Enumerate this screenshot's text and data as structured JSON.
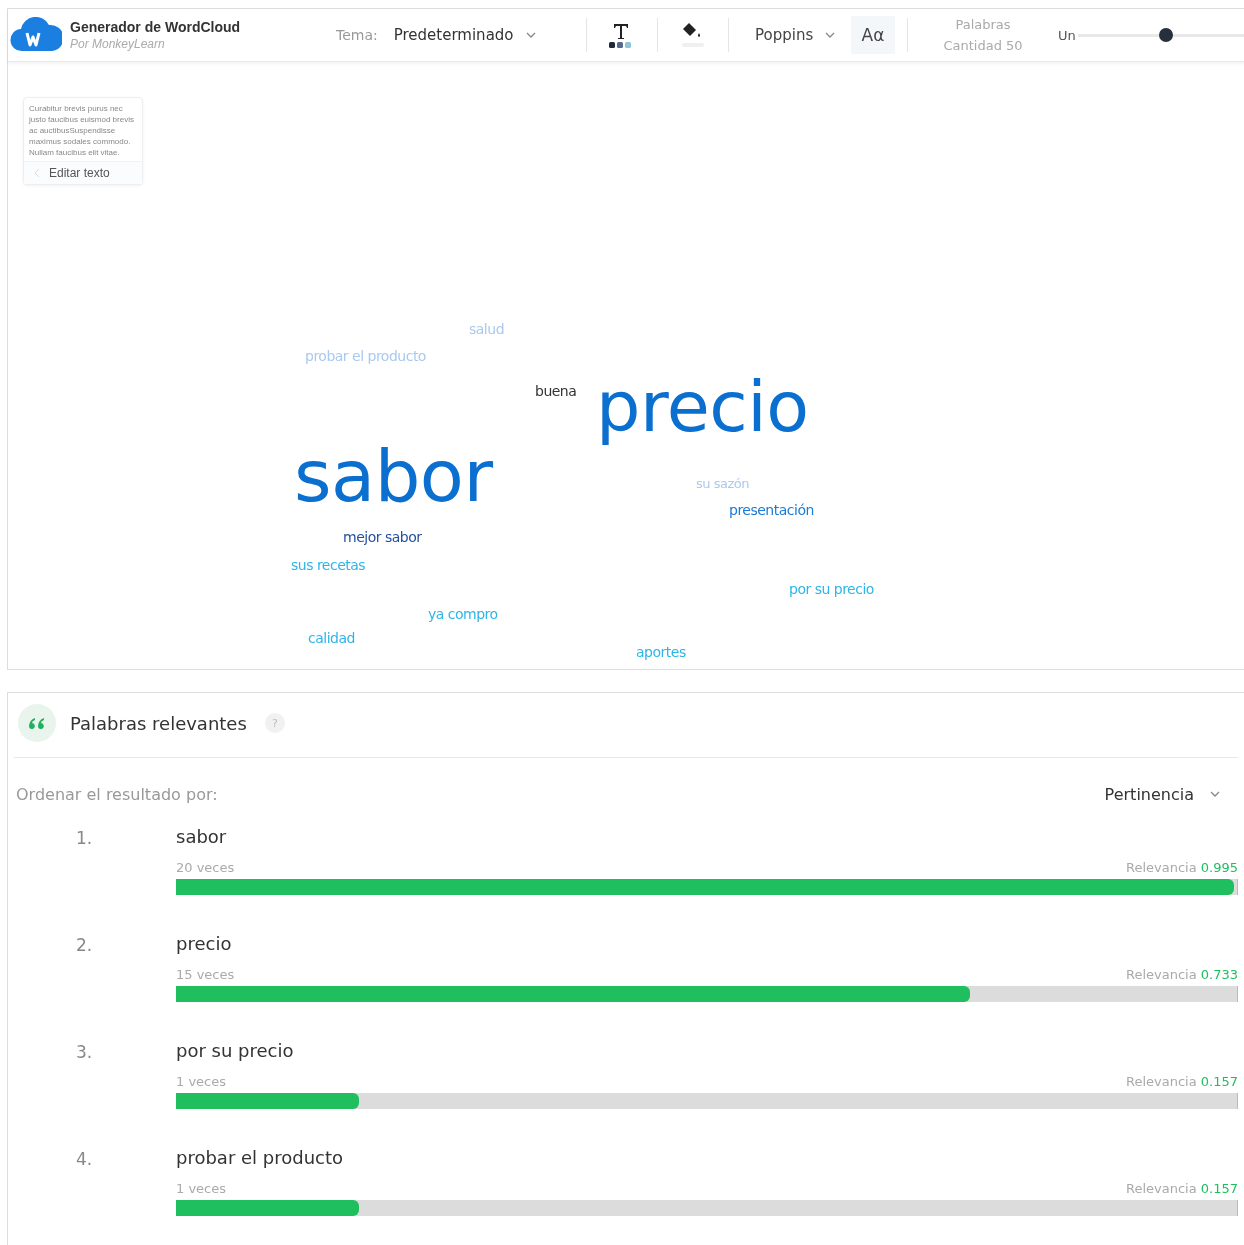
{
  "app": {
    "title": "Generador de WordCloud",
    "subtitle": "Por MonkeyLearn"
  },
  "toolbar": {
    "theme_label": "Tema:",
    "theme": "Predeterminado",
    "font": "Poppins",
    "case_button": "Aα",
    "words_label": "Palabras",
    "words_count": "Cantidad 50",
    "slider_label": "Un",
    "slider": {
      "level": 0.53
    }
  },
  "text_card": {
    "preview": "Curabitur brevis purus nec justo faucibus euismod brevis ac auctibusSuspendisse maximus sodales commodo. Nullam faucibus elit vitae.",
    "edit_button": "Editar texto"
  },
  "cloud": [
    {
      "text": "salud",
      "color": "#a9c9ef"
    },
    {
      "text": "probar el producto",
      "color": "#a9c9ef"
    },
    {
      "text": "buena",
      "color": "#333333"
    },
    {
      "text": "precio",
      "color": "#0b6fd0"
    },
    {
      "text": "sabor",
      "color": "#0b6fd0"
    },
    {
      "text": "su sazón",
      "color": "#a9c9ef"
    },
    {
      "text": "presentación",
      "color": "#1b7ad6"
    },
    {
      "text": "mejor sabor",
      "color": "#23509e"
    },
    {
      "text": "sus recetas",
      "color": "#2eb5e8"
    },
    {
      "text": "por su precio",
      "color": "#2eb5e8"
    },
    {
      "text": "ya compro",
      "color": "#2eb5e8"
    },
    {
      "text": "calidad",
      "color": "#2eb5e8"
    },
    {
      "text": "aportes",
      "color": "#2eb5e8"
    }
  ],
  "results": {
    "title": "Palabras relevantes",
    "help": "?",
    "sort_label": "Ordenar el resultado por:",
    "sort_value": "Pertinencia",
    "rows": [
      {
        "rank": "1.",
        "word": "sabor",
        "count": "20 veces",
        "relevance_label": "Relevancia",
        "relevance": "0.995",
        "level": 1.0
      },
      {
        "rank": "2.",
        "word": "precio",
        "count": "15 veces",
        "relevance_label": "Relevancia",
        "relevance": "0.733",
        "level": 0.75
      },
      {
        "rank": "3.",
        "word": "por su precio",
        "count": "1 veces",
        "relevance_label": "Relevancia",
        "relevance": "0.157",
        "level": 0.173
      },
      {
        "rank": "4.",
        "word": "probar el producto",
        "count": "1 veces",
        "relevance_label": "Relevancia",
        "relevance": "0.157",
        "level": 0.173
      }
    ]
  }
}
